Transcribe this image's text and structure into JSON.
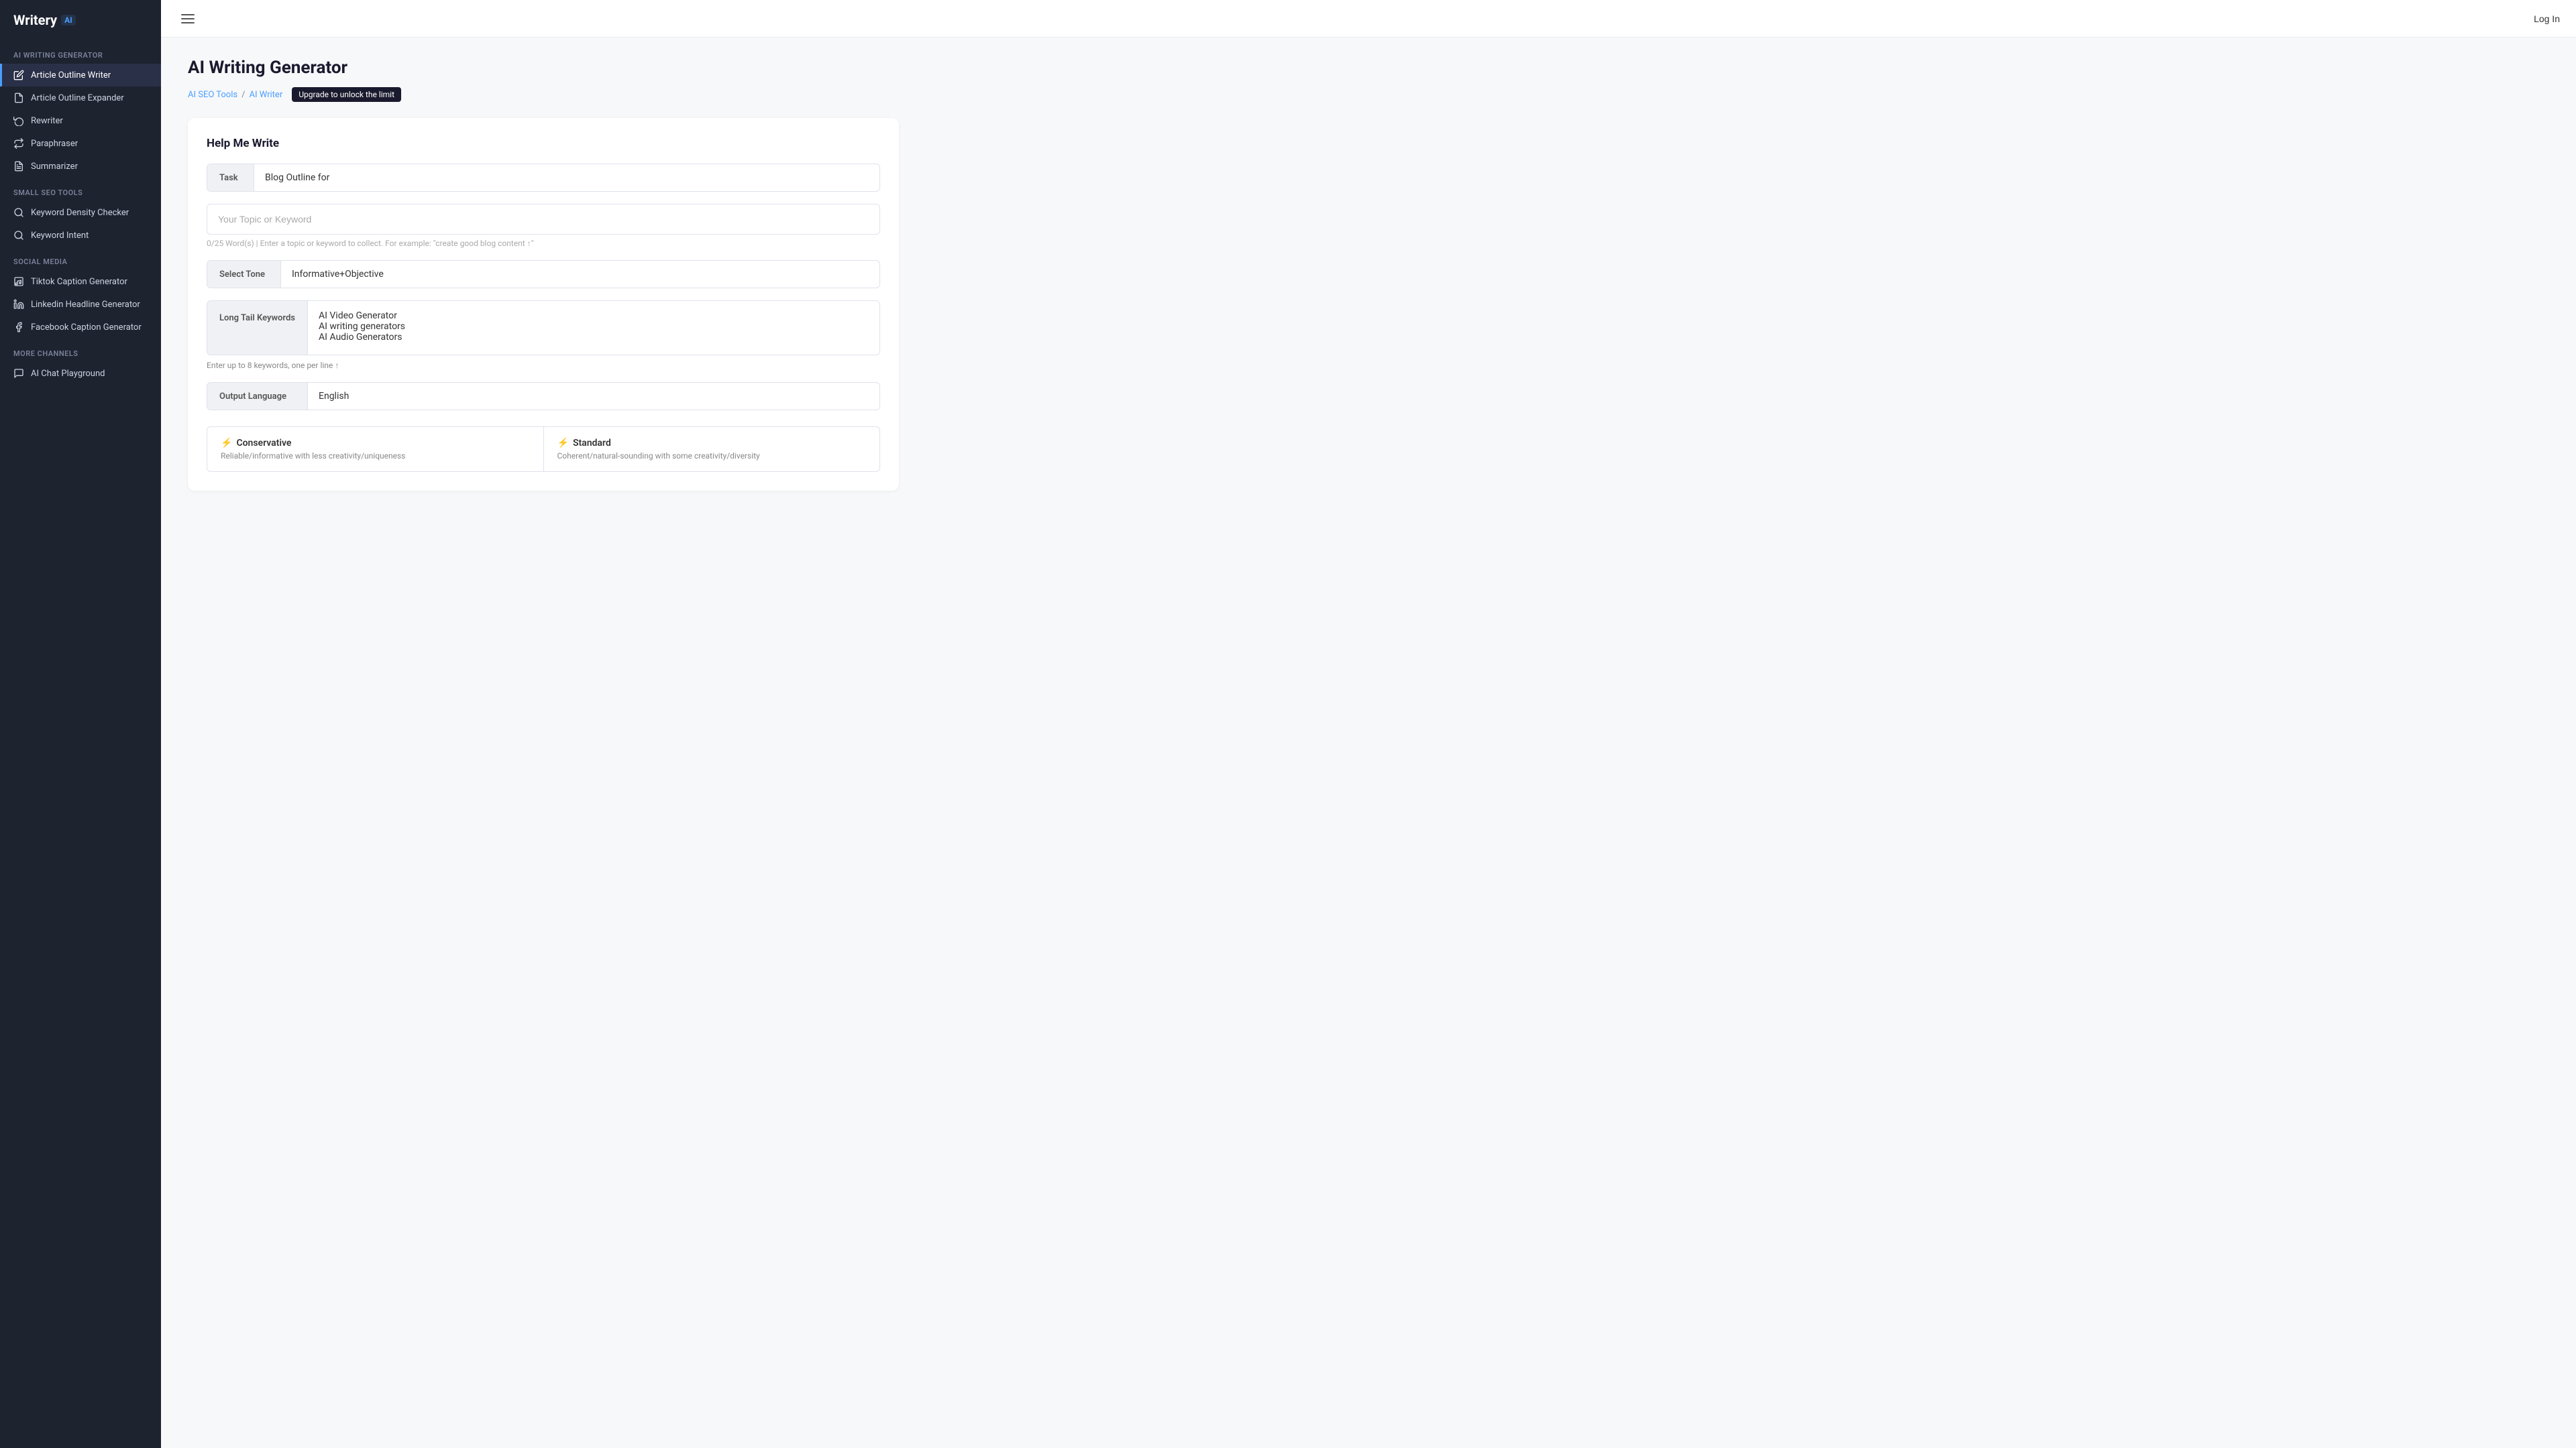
{
  "app": {
    "name": "Writery",
    "name_suffix": "AI",
    "login_label": "Log In"
  },
  "sidebar": {
    "section_writing": "AI Writing Generator",
    "section_seo": "Small SEO Tools",
    "section_social": "Social Media",
    "section_more": "More Channels",
    "items": [
      {
        "id": "article-outline-writer",
        "label": "Article Outline Writer",
        "active": true,
        "icon": "edit-icon"
      },
      {
        "id": "article-outline-expander",
        "label": "Article Outline Expander",
        "active": false,
        "icon": "file-icon"
      },
      {
        "id": "rewriter",
        "label": "Rewriter",
        "active": false,
        "icon": "refresh-icon"
      },
      {
        "id": "paraphraser",
        "label": "Paraphraser",
        "active": false,
        "icon": "swap-icon"
      },
      {
        "id": "summarizer",
        "label": "Summarizer",
        "active": false,
        "icon": "doc-icon"
      },
      {
        "id": "keyword-density-checker",
        "label": "Keyword Density Checker",
        "active": false,
        "icon": "seo-icon"
      },
      {
        "id": "keyword-intent",
        "label": "Keyword Intent",
        "active": false,
        "icon": "seo2-icon"
      },
      {
        "id": "tiktok-caption-generator",
        "label": "Tiktok Caption Generator",
        "active": false,
        "icon": "social-icon"
      },
      {
        "id": "linkedin-headline-generator",
        "label": "Linkedin Headline Generator",
        "active": false,
        "icon": "social2-icon"
      },
      {
        "id": "facebook-caption-generator",
        "label": "Facebook Caption Generator",
        "active": false,
        "icon": "social3-icon"
      },
      {
        "id": "ai-chat-playground",
        "label": "AI Chat Playground",
        "active": false,
        "icon": "chat-icon"
      }
    ]
  },
  "header": {
    "page_title": "AI Writing Generator",
    "breadcrumb_link1": "AI SEO Tools",
    "breadcrumb_sep": "/",
    "breadcrumb_link2": "AI Writer",
    "upgrade_badge": "Upgrade to unlock the limit"
  },
  "form": {
    "section_title": "Help Me Write",
    "task_label": "Task",
    "task_value": "Blog Outline for",
    "topic_placeholder": "Your Topic or Keyword",
    "word_count": "0/25 Word(s)",
    "word_count_hint": "| Enter a topic or keyword to collect. For example: \"create good blog content ↑\"",
    "select_tone_label": "Select Tone",
    "select_tone_value": "Informative+Objective",
    "keywords_label": "Long Tail Keywords",
    "keywords_lines": [
      "AI Video Generator",
      "AI writing generators",
      "AI Audio Generators"
    ],
    "keywords_hint": "Enter up to 8 keywords, one per line ↑",
    "output_language_label": "Output Language",
    "output_language_value": "English",
    "creativity_options": [
      {
        "icon": "⚡",
        "title": "Conservative",
        "desc": "Reliable/informative with less creativity/uniqueness"
      },
      {
        "icon": "⚡",
        "title": "Standard",
        "desc": "Coherent/natural-sounding with some creativity/diversity"
      }
    ]
  }
}
